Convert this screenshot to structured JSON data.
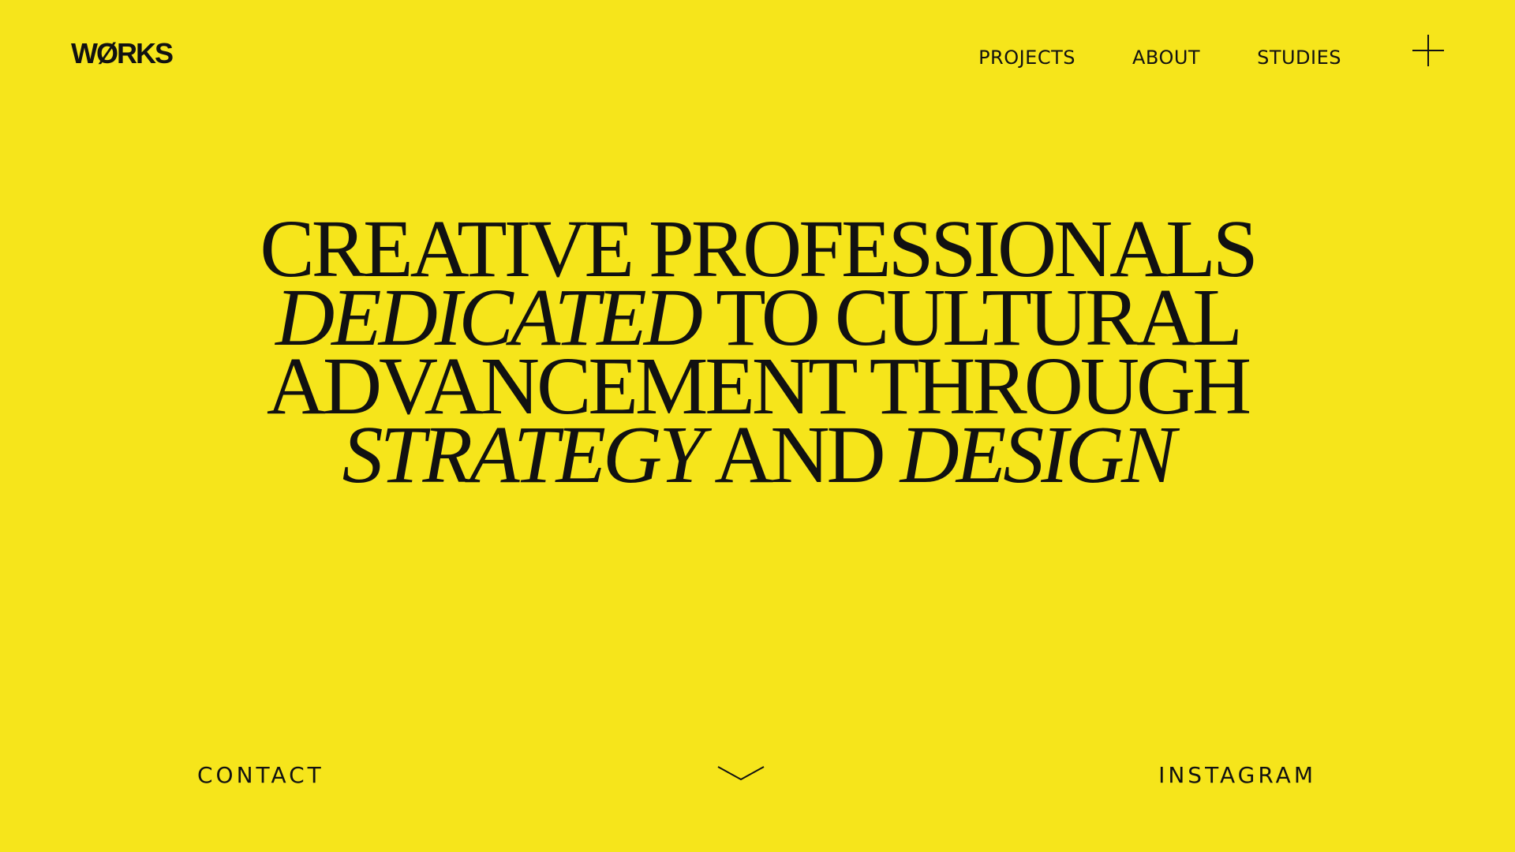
{
  "brand": {
    "logo_text": "WØRKS"
  },
  "nav": {
    "items": [
      {
        "label": "PROJECTS"
      },
      {
        "label": "ABOUT"
      },
      {
        "label": "STUDIES"
      }
    ],
    "menu_icon": "plus-icon"
  },
  "hero": {
    "lines": [
      [
        {
          "text": "CREATIVE PROFESSIONALS",
          "italic": false
        }
      ],
      [
        {
          "text": "DEDICATED",
          "italic": true
        },
        {
          "text": " TO CULTURAL",
          "italic": false
        }
      ],
      [
        {
          "text": "ADVANCEMENT THROUGH",
          "italic": false
        }
      ],
      [
        {
          "text": "STRATEGY",
          "italic": true
        },
        {
          "text": " AND ",
          "italic": false
        },
        {
          "text": "DESIGN",
          "italic": true
        }
      ]
    ]
  },
  "footer": {
    "contact_label": "CONTACT",
    "instagram_label": "INSTAGRAM",
    "scroll_icon": "chevron-down-icon"
  },
  "colors": {
    "background": "#f6e51b",
    "text": "#111111"
  }
}
